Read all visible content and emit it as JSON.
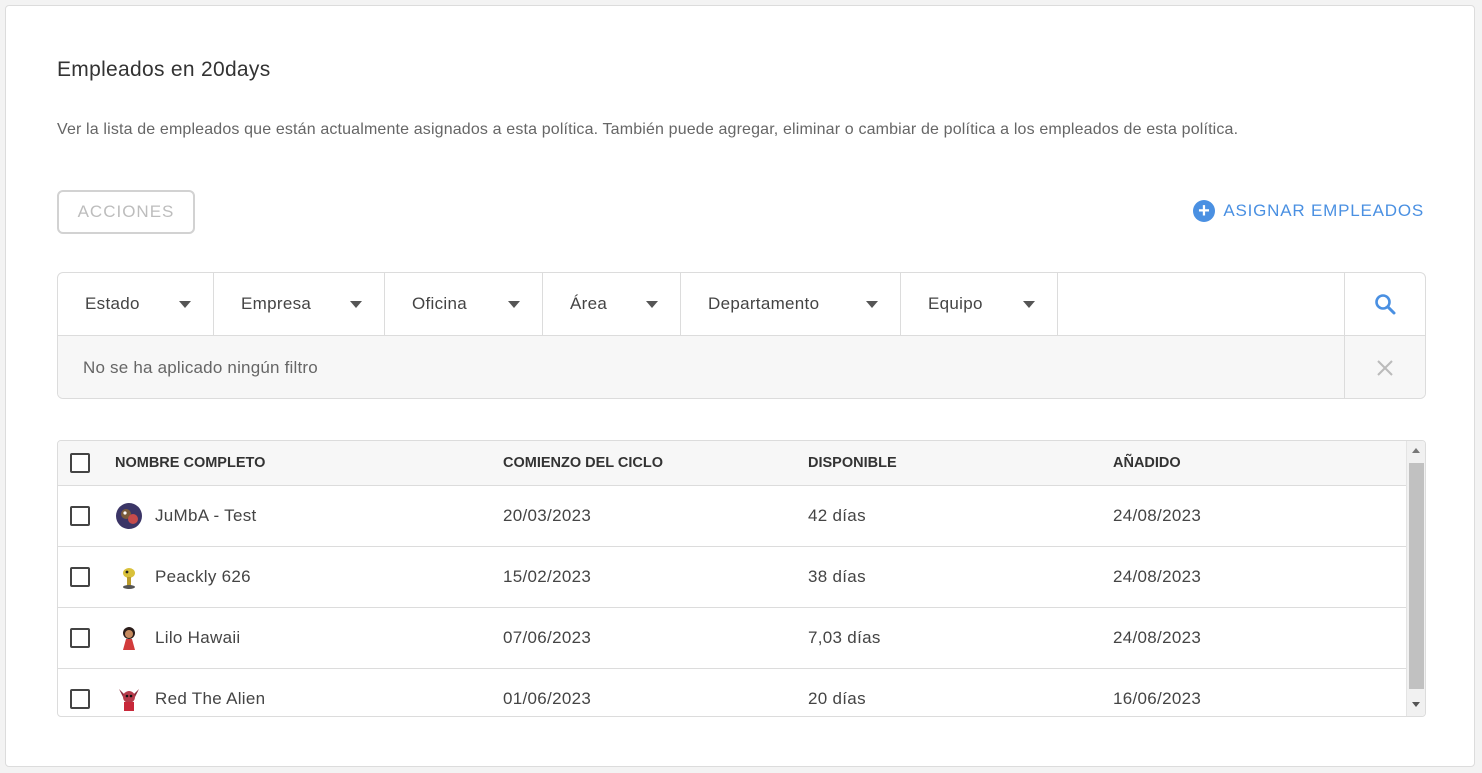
{
  "header": {
    "title": "Empleados en 20days",
    "description": "Ver la lista de empleados que están actualmente asignados a esta política. También puede agregar, eliminar o cambiar de política a los empleados de esta política."
  },
  "actions": {
    "acciones_label": "ACCIONES",
    "assign_label": "ASIGNAR EMPLEADOS"
  },
  "filters": {
    "items": [
      {
        "label": "Estado"
      },
      {
        "label": "Empresa"
      },
      {
        "label": "Oficina"
      },
      {
        "label": "Área"
      },
      {
        "label": "Departamento"
      },
      {
        "label": "Equipo"
      }
    ],
    "status": "No se ha aplicado ningún filtro"
  },
  "table": {
    "columns": [
      "NOMBRE COMPLETO",
      "COMIENZO DEL CICLO",
      "DISPONIBLE",
      "AÑADIDO"
    ],
    "rows": [
      {
        "name": "JuMbA - Test",
        "cycle_start": "20/03/2023",
        "available": "42 días",
        "added": "24/08/2023"
      },
      {
        "name": "Peackly 626",
        "cycle_start": "15/02/2023",
        "available": "38 días",
        "added": "24/08/2023"
      },
      {
        "name": "Lilo Hawaii",
        "cycle_start": "07/06/2023",
        "available": "7,03 días",
        "added": "24/08/2023"
      },
      {
        "name": "Red The Alien",
        "cycle_start": "01/06/2023",
        "available": "20 días",
        "added": "16/06/2023"
      }
    ]
  },
  "colors": {
    "accent": "#4a90e2",
    "border": "#dcdcdc",
    "muted_text": "#666666"
  }
}
